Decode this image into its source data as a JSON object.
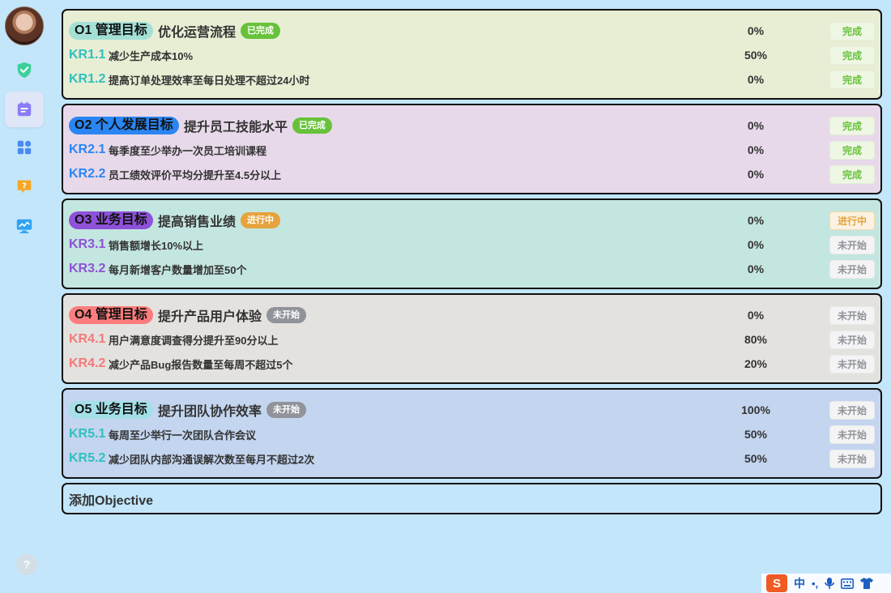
{
  "sidebar": {
    "icons": [
      "avatar",
      "shield-check-icon",
      "calendar-icon",
      "apps-grid-icon",
      "help-chat-icon",
      "monitor-chart-icon"
    ],
    "help_label": "?"
  },
  "objectives": [
    {
      "label": "O1 管理目标",
      "title": "优化运营流程",
      "status": "已完成",
      "status_color": "#67c23a",
      "label_bg": "#a4e0d6",
      "label_color": "#111",
      "card_bg": "#e7eed4",
      "kr_color": "#2fc0bf",
      "progress": "0%",
      "action": "完成",
      "action_type": "done",
      "krs": [
        {
          "code": "KR1.1",
          "title": "减少生产成本10%",
          "progress": "50%",
          "action": "完成",
          "action_type": "done"
        },
        {
          "code": "KR1.2",
          "title": "提高订单处理效率至每日处理不超过24小时",
          "progress": "0%",
          "action": "完成",
          "action_type": "done"
        }
      ]
    },
    {
      "label": "O2 个人发展目标",
      "title": "提升员工技能水平",
      "status": "已完成",
      "status_color": "#67c23a",
      "label_bg": "#2a86f3",
      "label_color": "#111",
      "card_bg": "#e8d9ea",
      "kr_color": "#2a86f3",
      "progress": "0%",
      "action": "完成",
      "action_type": "done",
      "krs": [
        {
          "code": "KR2.1",
          "title": "每季度至少举办一次员工培训课程",
          "progress": "0%",
          "action": "完成",
          "action_type": "done"
        },
        {
          "code": "KR2.2",
          "title": "员工绩效评价平均分提升至4.5分以上",
          "progress": "0%",
          "action": "完成",
          "action_type": "done"
        }
      ]
    },
    {
      "label": "O3 业务目标",
      "title": "提高销售业绩",
      "status": "进行中",
      "status_color": "#e6a23c",
      "label_bg": "#8e51d8",
      "label_color": "#111",
      "card_bg": "#c4e6e0",
      "kr_color": "#8e51d8",
      "progress": "0%",
      "action": "进行中",
      "action_type": "progress",
      "krs": [
        {
          "code": "KR3.1",
          "title": "销售额增长10%以上",
          "progress": "0%",
          "action": "未开始",
          "action_type": "notstart"
        },
        {
          "code": "KR3.2",
          "title": "每月新增客户数量增加至50个",
          "progress": "0%",
          "action": "未开始",
          "action_type": "notstart"
        }
      ]
    },
    {
      "label": "O4 管理目标",
      "title": "提升产品用户体验",
      "status": "未开始",
      "status_color": "#909399",
      "label_bg": "#fb7d7d",
      "label_color": "#111",
      "card_bg": "#e4e2de",
      "kr_color": "#f37979",
      "progress": "0%",
      "action": "未开始",
      "action_type": "notstart",
      "krs": [
        {
          "code": "KR4.1",
          "title": "用户满意度调查得分提升至90分以上",
          "progress": "80%",
          "action": "未开始",
          "action_type": "notstart"
        },
        {
          "code": "KR4.2",
          "title": "减少产品Bug报告数量至每周不超过5个",
          "progress": "20%",
          "action": "未开始",
          "action_type": "notstart"
        }
      ]
    },
    {
      "label": "O5 业务目标",
      "title": "提升团队协作效率",
      "status": "未开始",
      "status_color": "#909399",
      "label_bg": "#a4e0e8",
      "label_color": "#111",
      "card_bg": "#c3d5ef",
      "kr_color": "#2fc0bf",
      "progress": "100%",
      "action": "未开始",
      "action_type": "notstart",
      "krs": [
        {
          "code": "KR5.1",
          "title": "每周至少举行一次团队合作会议",
          "progress": "50%",
          "action": "未开始",
          "action_type": "notstart"
        },
        {
          "code": "KR5.2",
          "title": "减少团队内部沟通误解次数至每月不超过2次",
          "progress": "50%",
          "action": "未开始",
          "action_type": "notstart"
        }
      ]
    }
  ],
  "add_objective_label": "添加Objective",
  "ime": {
    "logo": "S",
    "lang": "中",
    "punct": "•,"
  }
}
